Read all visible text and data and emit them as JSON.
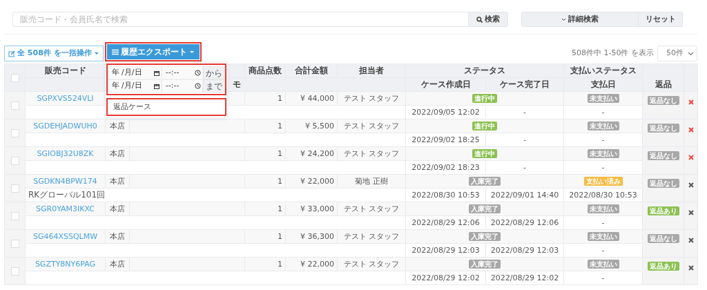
{
  "search": {
    "placeholder": "販売コード・会員氏名で検索",
    "button": "検索",
    "advanced_button": "詳細検索",
    "reset_button": "リセット"
  },
  "toolbar": {
    "bulk_button": "全 508件 を一括操作",
    "export_button": {
      "label": "履歴エクスポート",
      "highlighted": true
    },
    "range_text": "508件中 1-50件 を表示",
    "page_size": "50件"
  },
  "export_menu": {
    "dates_highlighted": true,
    "date_rows": [
      {
        "date_placeholder": "年 /月/日",
        "time_placeholder": "--:--",
        "suffix": "から"
      },
      {
        "date_placeholder": "年 /月/日",
        "time_placeholder": "--:--",
        "suffix": "まで"
      }
    ],
    "items": [
      {
        "label": "返品ケース",
        "highlighted": true
      }
    ]
  },
  "table": {
    "header_checked": false,
    "header_top": {
      "code": "販売コード",
      "quantity": "商品点数",
      "total": "合計金額",
      "staff": "担当者",
      "status": "ステータス",
      "payment_status": "支払いステータス",
      "returns": "返品"
    },
    "header_bottom": {
      "memo": "モ",
      "created": "ケース作成日",
      "completed": "ケース完了日",
      "paid_date": "支払日"
    },
    "rows": [
      {
        "checked": false,
        "code": "SGPXVS524VLI",
        "quantity": "1",
        "total": "¥ 44,000",
        "staff": "テスト スタッフ",
        "status": {
          "label": "進行中",
          "color": "#8cc152"
        },
        "created": "2022/09/05 12:02",
        "completed": "-",
        "payment": {
          "label": "未支払い",
          "color": "#a8a8a8"
        },
        "paid_date": "-",
        "returns": {
          "label": "返品なし",
          "color": "#a8a8a8"
        },
        "delete_active": true
      },
      {
        "checked": false,
        "code": "SGDEHJADWUH0",
        "store": "本店",
        "quantity": "1",
        "total": "¥ 5,500",
        "staff": "テスト スタッフ",
        "status": {
          "label": "進行中",
          "color": "#8cc152"
        },
        "created": "2022/09/02 18:25",
        "completed": "-",
        "payment": {
          "label": "未支払い",
          "color": "#a8a8a8"
        },
        "paid_date": "-",
        "returns": {
          "label": "返品なし",
          "color": "#a8a8a8"
        },
        "delete_active": true
      },
      {
        "checked": false,
        "code": "SGIOBJ32U8ZK",
        "store": "本店",
        "quantity": "1",
        "total": "¥ 24,200",
        "staff": "テスト スタッフ",
        "status": {
          "label": "進行中",
          "color": "#8cc152"
        },
        "created": "2022/09/02 18:23",
        "completed": "-",
        "payment": {
          "label": "未支払い",
          "color": "#a8a8a8"
        },
        "paid_date": "-",
        "returns": {
          "label": "返品なし",
          "color": "#a8a8a8"
        },
        "delete_active": true
      },
      {
        "checked": false,
        "code": "SGDKN4BPW174",
        "store": "本店",
        "memo": "RKグローバル101回",
        "quantity": "1",
        "total": "¥ 22,000",
        "staff": "菊地 正樹",
        "status": {
          "label": "入庫完了",
          "color": "#a8a8a8"
        },
        "created": "2022/08/30 10:53",
        "completed": "2022/09/01 14:40",
        "payment": {
          "label": "支払い済み",
          "color": "#f6bb42"
        },
        "paid_date": "2022/08/30 10:53",
        "returns": {
          "label": "返品なし",
          "color": "#a8a8a8"
        },
        "delete_active": false
      },
      {
        "checked": false,
        "code": "SGR0YAM3IKXC",
        "store": "本店",
        "quantity": "1",
        "total": "¥ 33,000",
        "staff": "テスト スタッフ",
        "status": {
          "label": "入庫完了",
          "color": "#a8a8a8"
        },
        "created": "2022/08/29 12:06",
        "completed": "2022/08/29 12:06",
        "payment": {
          "label": "未支払い",
          "color": "#a8a8a8"
        },
        "paid_date": "-",
        "returns": {
          "label": "返品あり",
          "color": "#8cc152"
        },
        "delete_active": false
      },
      {
        "checked": false,
        "code": "SG464XSSQLMW",
        "store": "本店",
        "quantity": "1",
        "total": "¥ 36,300",
        "staff": "テスト スタッフ",
        "status": {
          "label": "入庫完了",
          "color": "#a8a8a8"
        },
        "created": "2022/08/29 12:03",
        "completed": "2022/08/29 12:03",
        "payment": {
          "label": "未支払い",
          "color": "#a8a8a8"
        },
        "paid_date": "-",
        "returns": {
          "label": "返品なし",
          "color": "#a8a8a8"
        },
        "delete_active": false
      },
      {
        "checked": false,
        "code": "SGZTY8NY6PAG",
        "store": "本店",
        "quantity": "1",
        "total": "¥ 22,000",
        "staff": "テスト スタッフ",
        "status": {
          "label": "入庫完了",
          "color": "#a8a8a8"
        },
        "created": "2022/08/29 12:02",
        "completed": "2022/08/29 12:02",
        "payment": {
          "label": "未支払い",
          "color": "#a8a8a8"
        },
        "paid_date": "-",
        "returns": {
          "label": "返品あり",
          "color": "#8cc152"
        },
        "delete_active": false
      }
    ]
  }
}
